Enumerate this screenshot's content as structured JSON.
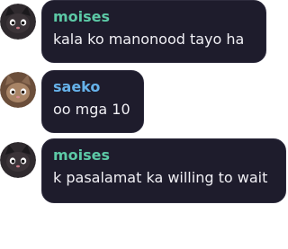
{
  "colors": {
    "bubble_bg": "#1e1c2c",
    "moises_name": "#5cc9a6",
    "saeko_name": "#66b2ea",
    "text": "#f1f0f5"
  },
  "messages": [
    {
      "author": "moises",
      "avatar_icon": "dark-cat-avatar-icon",
      "text": "kala ko manonood tayo ha"
    },
    {
      "author": "saeko",
      "avatar_icon": "brown-cat-avatar-icon",
      "text": "oo mga 10"
    },
    {
      "author": "moises",
      "avatar_icon": "dark-cat-avatar-icon",
      "text": "k pasalamat ka willing to wait"
    }
  ]
}
